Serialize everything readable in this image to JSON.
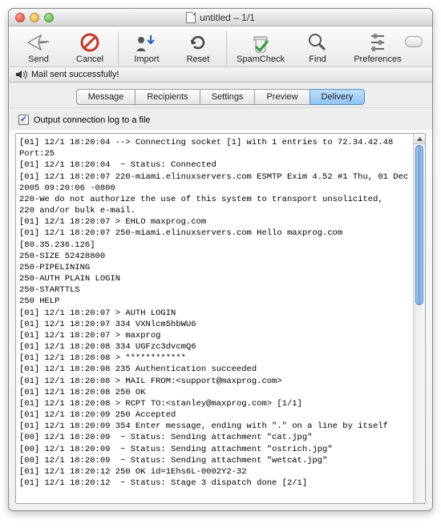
{
  "window": {
    "title": "untitled – 1/1"
  },
  "toolbar": {
    "send": "Send",
    "cancel": "Cancel",
    "import": "Import",
    "reset": "Reset",
    "spamcheck": "SpamCheck",
    "find": "Find",
    "preferences": "Preferences"
  },
  "status": "Mail sent successfully!",
  "tabs": {
    "message": "Message",
    "recipients": "Recipients",
    "settings": "Settings",
    "preview": "Preview",
    "delivery": "Delivery"
  },
  "options": {
    "output_log": "Output connection log to a file",
    "output_log_checked": true
  },
  "log_lines": [
    "[01] 12/1 18:20:04 --> Connecting socket [1] with 1 entries to 72.34.42.48",
    "Port:25",
    "[01] 12/1 18:20:04  ~ Status: Connected",
    "[01] 12/1 18:20:07 220-miami.elinuxservers.com ESMTP Exim 4.52 #1 Thu, 01 Dec",
    "2005 09:20:06 -0800",
    "220-We do not authorize the use of this system to transport unsolicited,",
    "220 and/or bulk e-mail.",
    "[01] 12/1 18:20:07 > EHLO maxprog.com",
    "[01] 12/1 18:20:07 250-miami.elinuxservers.com Hello maxprog.com",
    "[80.35.236.126]",
    "250-SIZE 52428800",
    "250-PIPELINING",
    "250-AUTH PLAIN LOGIN",
    "250-STARTTLS",
    "250 HELP",
    "[01] 12/1 18:20:07 > AUTH LOGIN",
    "[01] 12/1 18:20:07 334 VXNlcm5hbWU6",
    "[01] 12/1 18:20:07 > maxprog",
    "[01] 12/1 18:20:08 334 UGFzc3dvcmQ6",
    "[01] 12/1 18:20:08 > ************",
    "[01] 12/1 18:20:08 235 Authentication succeeded",
    "[01] 12/1 18:20:08 > MAIL FROM:<support@maxprog.com>",
    "[01] 12/1 18:20:08 250 OK",
    "[01] 12/1 18:20:08 > RCPT TO:<stanley@maxprog.com> [1/1]",
    "[01] 12/1 18:20:09 250 Accepted",
    "[01] 12/1 18:20:09 354 Enter message, ending with \".\" on a line by itself",
    "[00] 12/1 18:20:09  ~ Status: Sending attachment \"cat.jpg\"",
    "[00] 12/1 18:20:09  ~ Status: Sending attachment \"ostrich.jpg\"",
    "[00] 12/1 18:20:09  ~ Status: Sending attachment \"wetcat.jpg\"",
    "[01] 12/1 18:20:12 250 OK id=1Ehs6L-0002Y2-32",
    "[01] 12/1 18:20:12  ~ Status: Stage 3 dispatch done [2/1]"
  ]
}
